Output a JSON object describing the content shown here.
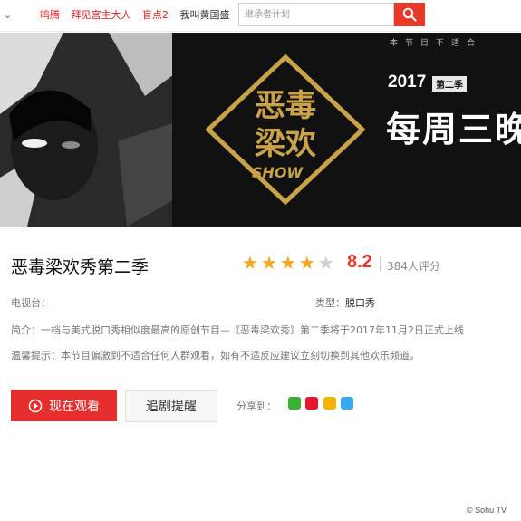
{
  "nav": {
    "links": [
      "鸣腾",
      "拜见宫主大人",
      "盲点2",
      "我叫黄国盛"
    ],
    "search_placeholder": "继承者计划"
  },
  "banner": {
    "notice": "本节目不适合",
    "year": "2017",
    "season": "第二季",
    "tagline": "每周三晚",
    "logo": {
      "line1": "恶毒",
      "line2": "梁欢",
      "sub": "SHOW"
    }
  },
  "show": {
    "title": "恶毒梁欢秀第二季",
    "rating_stars": 4,
    "rating_max": 5,
    "score": "8.2",
    "ratings_count": "384人评分",
    "tv_label": "电视台：",
    "type_label": "类型：",
    "type_value": "脱口秀",
    "intro": "简介：一档与美式脱口秀相似度最高的原创节目—《恶毒梁欢秀》第二季将于2017年11月2日正式上线",
    "warning": "温馨提示：本节目偏激到不适合任何人群观看，如有不适反应建议立刻切换到其他欢乐频道。"
  },
  "actions": {
    "watch": "现在观看",
    "follow": "追剧提醒",
    "share_label": "分享到："
  },
  "colors": {
    "accent": "#e83828",
    "star": "#f5a623"
  },
  "watermark": "© Sohu TV"
}
